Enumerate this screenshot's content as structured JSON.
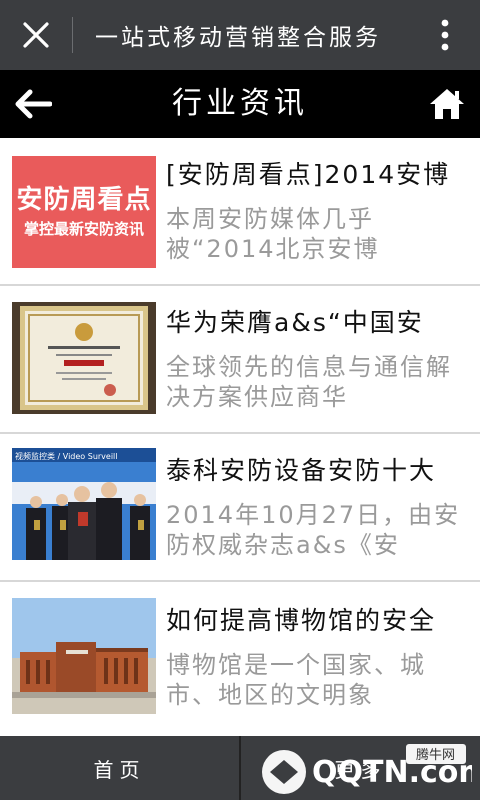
{
  "topbar": {
    "title": "一站式移动营销整合服务"
  },
  "header": {
    "title": "行业资讯"
  },
  "articles": [
    {
      "title": "[安防周看点]2014安博",
      "desc": "本周安防媒体几乎被“2014北京安博",
      "thumb_big": "安防周看点",
      "thumb_small": "掌控最新安防资讯"
    },
    {
      "title": "华为荣膺a&s“中国安",
      "desc": "全球领先的信息与通信解决方案供应商华"
    },
    {
      "title": "泰科安防设备安防十大",
      "desc": "2014年10月27日，由安防权威杂志a&s《安",
      "thumb_banner": "视频监控类 / Video Surveill"
    },
    {
      "title": "如何提高博物馆的安全",
      "desc": "博物馆是一个国家、城市、地区的文明象"
    }
  ],
  "bottom": {
    "home": "首页",
    "second": "更多"
  },
  "watermark": {
    "site": "QQTN.com",
    "tag": "腾牛网"
  },
  "colors": {
    "topbar": "#3b3d40",
    "header": "#000000",
    "thumb_red": "#e95b5b"
  }
}
